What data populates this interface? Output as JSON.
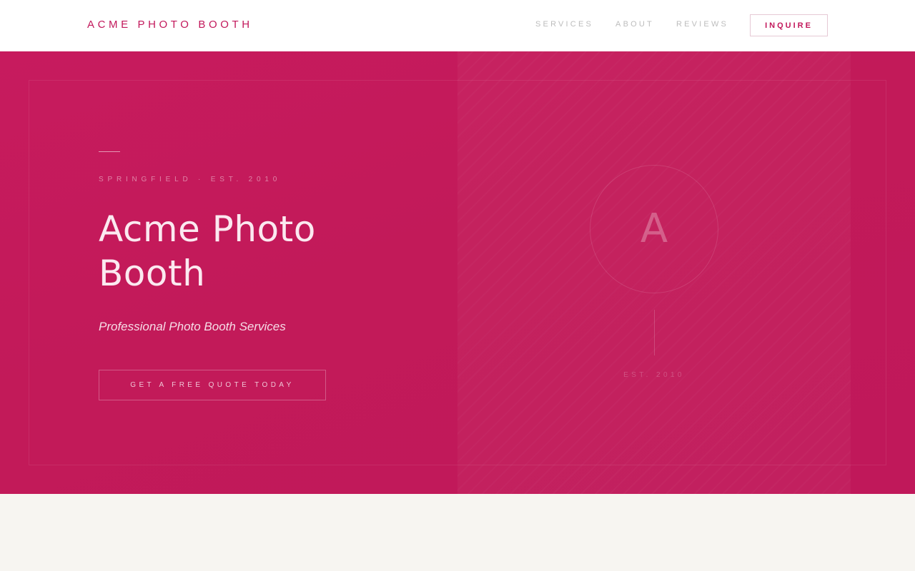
{
  "brand": {
    "name": "ACME PHOTO BOOTH"
  },
  "nav": {
    "links": [
      "SERVICES",
      "ABOUT",
      "REVIEWS"
    ],
    "cta_label": "INQUIRE"
  },
  "hero": {
    "eyebrow": "SPRINGFIELD · EST. 2010",
    "title": "Acme Photo Booth",
    "subtitle": "Professional Photo Booth Services",
    "cta_label": "GET A FREE QUOTE TODAY",
    "emblem": {
      "letter": "A",
      "caption": "EST. 2010"
    }
  },
  "colors": {
    "brand": "#c2185b",
    "hero_bg": "#c21a59",
    "page_bg": "#f7f5f1",
    "nav_link": "#bdbdbd"
  }
}
